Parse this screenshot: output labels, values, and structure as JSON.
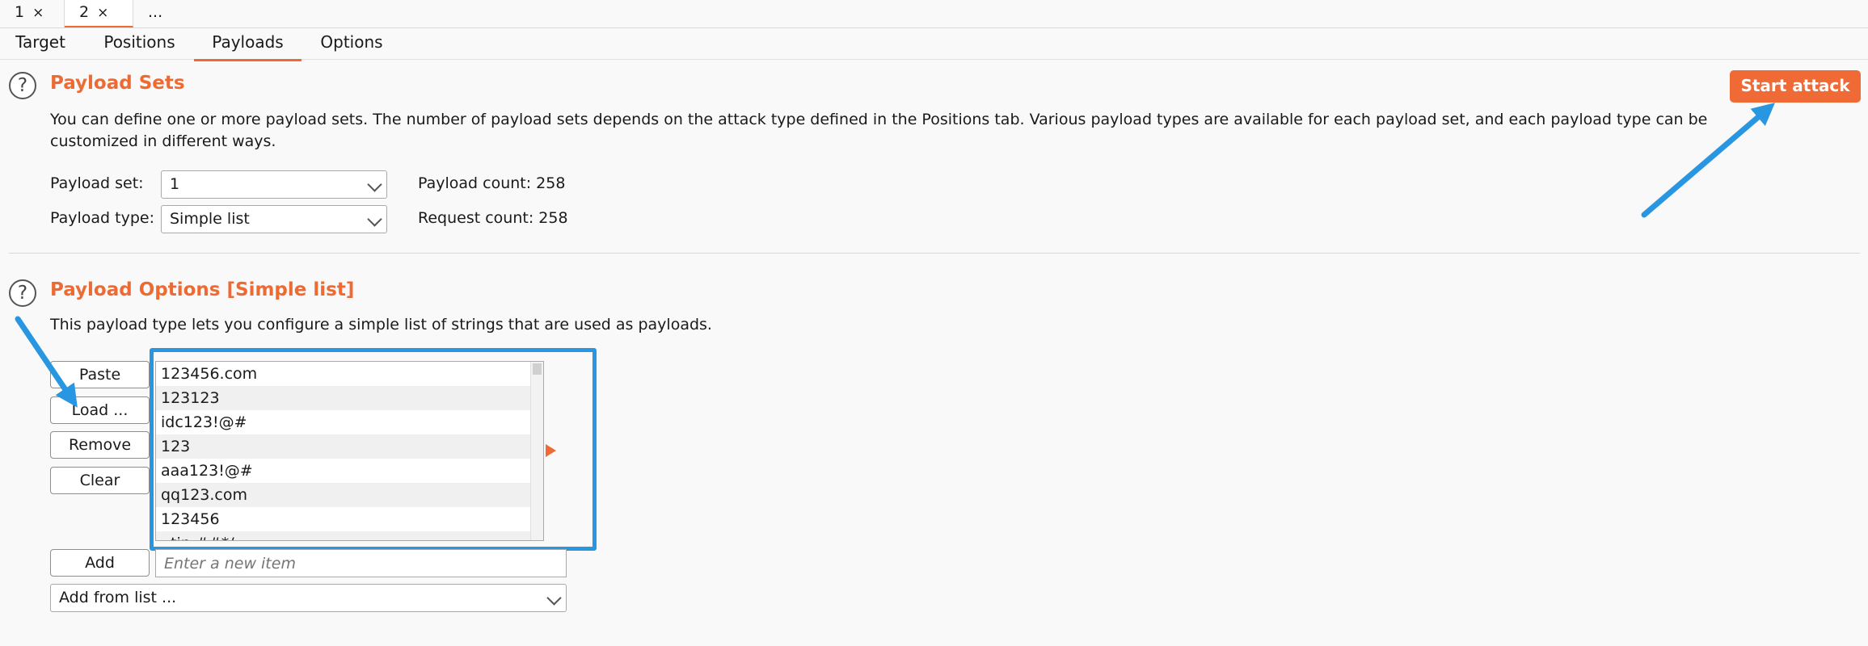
{
  "attack_tabs": [
    {
      "label": "1",
      "close": "×"
    },
    {
      "label": "2",
      "close": "×"
    },
    {
      "label": "..."
    }
  ],
  "sub_tabs": [
    "Target",
    "Positions",
    "Payloads",
    "Options"
  ],
  "active_sub_tab": "Payloads",
  "payload_sets": {
    "help": "?",
    "title": "Payload Sets",
    "description": "You can define one or more payload sets. The number of payload sets depends on the attack type defined in the Positions tab. Various payload types are available for each payload set, and each payload type can be customized in different ways.",
    "set_label": "Payload set:",
    "set_value": "1",
    "type_label": "Payload type:",
    "type_value": "Simple list",
    "payload_count": "Payload count: 258",
    "request_count": "Request count: 258",
    "start_button": "Start attack"
  },
  "payload_options": {
    "help": "?",
    "title": "Payload Options [Simple list]",
    "description": "This payload type lets you configure a simple list of strings that are used as payloads.",
    "buttons": {
      "paste": "Paste",
      "load": "Load ...",
      "remove": "Remove",
      "clear": "Clear",
      "add": "Add"
    },
    "items": [
      "123456.com",
      "123123",
      "idc123!@#",
      "123",
      "aaa123!@#",
      "qq123.com",
      "123456",
      "..tin.##*/"
    ],
    "new_item_placeholder": "Enter a new item",
    "add_from_list": "Add from list ..."
  },
  "colors": {
    "accent": "#f06a35",
    "annotation": "#2896e0"
  },
  "icons": [
    "help-icon",
    "close-icon",
    "chevron-down-icon",
    "expand-arrow-icon",
    "annotation-arrow"
  ]
}
